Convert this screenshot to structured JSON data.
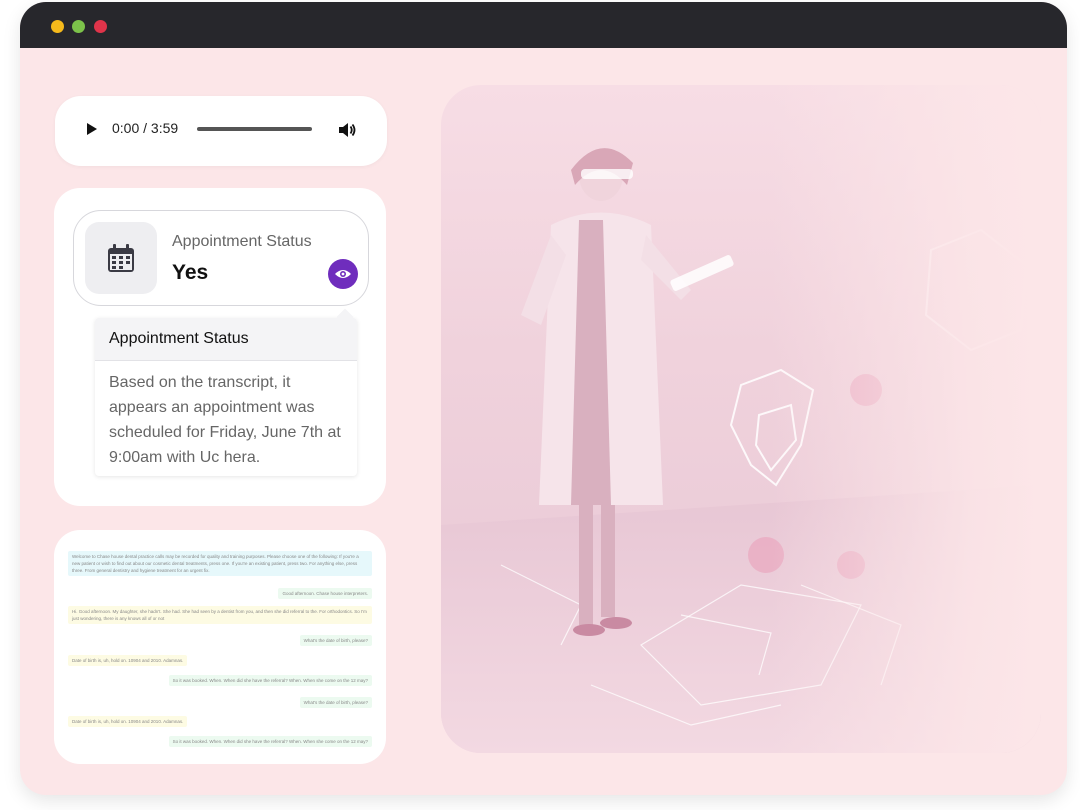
{
  "window": {
    "controls": [
      "minimize-dot",
      "maximize-dot",
      "close-dot"
    ]
  },
  "audio": {
    "time": "0:00 / 3:59",
    "progress": 0,
    "icons": [
      "play-icon",
      "volume-icon"
    ]
  },
  "status": {
    "label": "Appointment Status",
    "value": "Yes",
    "icons": [
      "calendar-icon",
      "eye-icon"
    ],
    "accent": "#6f2dbd"
  },
  "popover": {
    "title": "Appointment Status",
    "body": "Based on the transcript, it appears an appointment was scheduled for Friday, June 7th at 9:00am with Uc hera."
  },
  "transcript": {
    "messages": [
      {
        "text": "Welcome to Chase house dental practice calls may be recorded for quality and training purposes. Please choose one of the following: If you're a new patient or wish to find out about our cosmetic dental treatments, press one. If you're an existing patient, press two. For anything else, press three. From general dentistry and hygiene treatment for an urgent fix.",
        "color": "cyan"
      },
      {
        "text": "Good afternoon. Chase house interpreters.",
        "color": "green"
      },
      {
        "text": "Hi. Good afternoon. My daughter, she hadn't. She had. She had seen by a dentist from you, and then she did referral to the. For orthodontics. So I'm just wondering, there is any knows all of or not",
        "color": "yellow"
      },
      {
        "text": "What's the date of birth, please?",
        "color": "green"
      },
      {
        "text": "Date of birth is, uh, hold on. 10904 and 2010. Adamnas.",
        "color": "yellow"
      },
      {
        "text": "So it was booked. When. When did she have the referral? When. When she come on the 12 may?",
        "color": "green"
      },
      {
        "text": "What's the date of birth, please?",
        "color": "green"
      },
      {
        "text": "Date of birth is, uh, hold on. 10904 and 2010. Adamnas.",
        "color": "yellow"
      },
      {
        "text": "So it was booked. When. When did she have the referral? When. When she come on the 12 may?",
        "color": "green"
      }
    ]
  },
  "illustration": {
    "icon": "doctor-hologram-illustration"
  }
}
